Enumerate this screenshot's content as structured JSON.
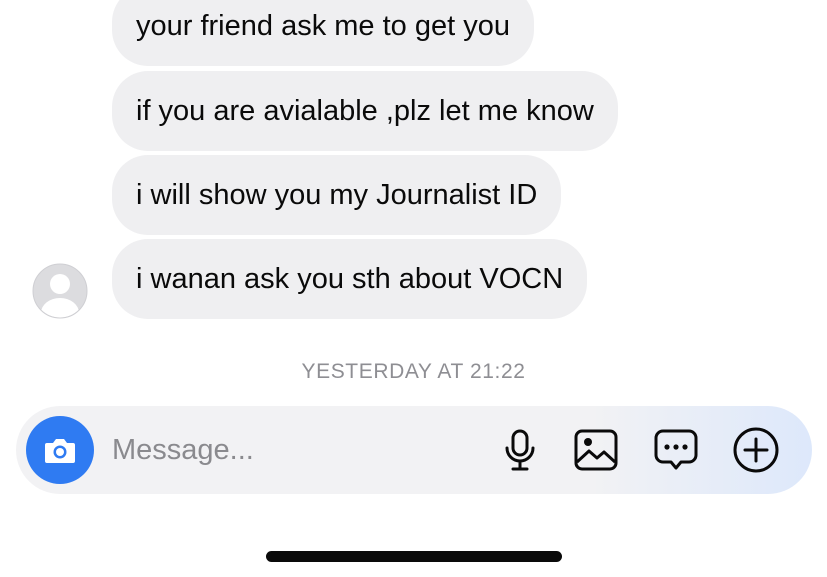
{
  "messages": [
    {
      "text": "your friend ask me to get you"
    },
    {
      "text": "if you are avialable ,plz let me know"
    },
    {
      "text": "i will show you my Journalist ID"
    },
    {
      "text": "i wanan ask you sth about VOCN"
    }
  ],
  "timestamp": "YESTERDAY AT 21:22",
  "composer": {
    "placeholder": "Message...",
    "icons": [
      "camera-icon",
      "microphone-icon",
      "image-icon",
      "chat-bubble-icon",
      "plus-circle-icon"
    ]
  },
  "colors": {
    "bubble": "#efeff1",
    "accent": "#2f7bf2",
    "timestamp": "#8e8e93"
  }
}
